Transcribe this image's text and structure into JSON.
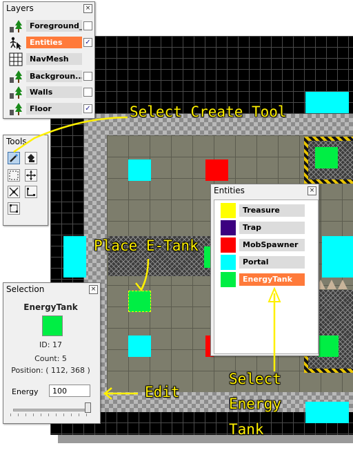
{
  "colors": {
    "treasure": "#ffff00",
    "trap": "#3c0080",
    "mobspawner": "#ff0000",
    "portal": "#00ffff",
    "energytank": "#00ee44",
    "selection_orange": "#ff7a3a",
    "annotation_yellow": "#fff000"
  },
  "layers": {
    "title": "Layers",
    "items": [
      {
        "name": "Foreground_...",
        "icon": "tree-layer-icon",
        "visible": false,
        "selected": false
      },
      {
        "name": "Entities",
        "icon": "entities-layer-icon",
        "visible": true,
        "selected": true
      },
      {
        "name": "NavMesh",
        "icon": "grid-layer-icon",
        "visible": false,
        "selected": false
      },
      {
        "name": "Backgroun...",
        "icon": "tree-layer-icon",
        "visible": false,
        "selected": false
      },
      {
        "name": "Walls",
        "icon": "tree-layer-icon",
        "visible": false,
        "selected": false
      },
      {
        "name": "Floor",
        "icon": "tree-layer-icon",
        "visible": true,
        "selected": false
      }
    ]
  },
  "tools": {
    "title": "Tools",
    "items": [
      {
        "name": "create-tool",
        "icon": "wand-icon",
        "active": true
      },
      {
        "name": "fill-tool",
        "icon": "bucket-icon",
        "active": false
      },
      {
        "name": "select-tool",
        "icon": "marquee-icon",
        "active": false
      },
      {
        "name": "move-tool",
        "icon": "move-arrows-icon",
        "active": false
      },
      {
        "name": "scale-tool",
        "icon": "scale-arrows-icon",
        "active": false
      },
      {
        "name": "resize-tool",
        "icon": "resize-corner-icon",
        "active": false
      },
      {
        "name": "bounds-tool",
        "icon": "bounds-icon",
        "active": false
      }
    ]
  },
  "entities": {
    "title": "Entities",
    "items": [
      {
        "name": "Treasure",
        "color": "#ffff00",
        "selected": false
      },
      {
        "name": "Trap",
        "color": "#3c0080",
        "selected": false
      },
      {
        "name": "MobSpawner",
        "color": "#ff0000",
        "selected": false
      },
      {
        "name": "Portal",
        "color": "#00ffff",
        "selected": false
      },
      {
        "name": "EnergyTank",
        "color": "#00ee44",
        "selected": true
      }
    ]
  },
  "selection": {
    "title": "Selection",
    "entity_name": "EnergyTank",
    "id_line": "ID: 17",
    "count_line": "Count: 5",
    "position_line": "Position: ( 112, 368 )",
    "field_label": "Energy",
    "field_value": "100",
    "slider_fraction": 1.0
  },
  "annotations": {
    "select_create_tool": "Select Create Tool",
    "place_etank": "Place E-Tank",
    "edit": "Edit",
    "select_energy_tank": [
      "Select",
      "Energy",
      "Tank"
    ]
  }
}
